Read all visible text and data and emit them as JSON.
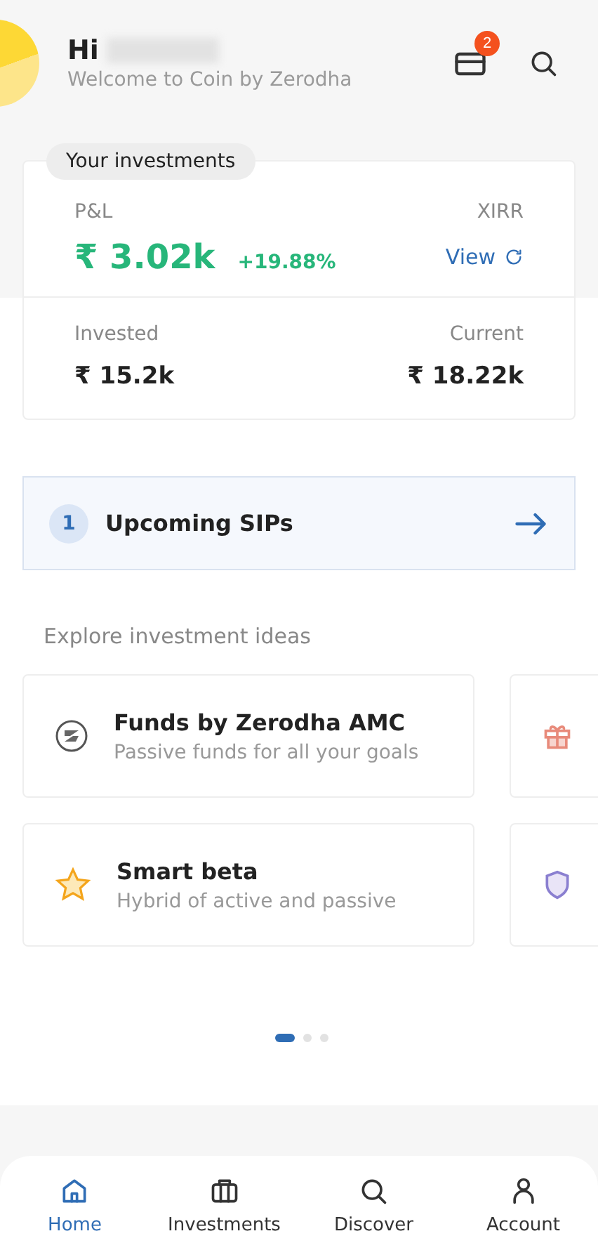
{
  "header": {
    "greeting": "Hi",
    "subtitle": "Welcome to Coin by Zerodha",
    "notification_count": "2"
  },
  "investments": {
    "tag": "Your investments",
    "pnl_label": "P&L",
    "pnl_value": "₹ 3.02k",
    "pnl_percent": "+19.88%",
    "xirr_label": "XIRR",
    "xirr_action": "View",
    "invested_label": "Invested",
    "invested_value": "₹ 15.2k",
    "current_label": "Current",
    "current_value": "₹ 18.22k"
  },
  "upcoming_sips": {
    "count": "1",
    "label": "Upcoming SIPs"
  },
  "explore": {
    "title": "Explore investment ideas",
    "ideas": [
      {
        "kind": "zerodha",
        "title": "Funds by Zerodha AMC",
        "subtitle": "Passive funds for all your goals"
      },
      {
        "kind": "gift"
      },
      {
        "kind": "star",
        "title": "Smart beta",
        "subtitle": "Hybrid of active and passive"
      },
      {
        "kind": "shield"
      }
    ],
    "pages": [
      {
        "selected": true
      },
      {
        "selected": false
      },
      {
        "selected": false
      }
    ]
  },
  "bottom_nav": [
    {
      "kind": "home",
      "label": "Home",
      "selected": true
    },
    {
      "kind": "briefcase",
      "label": "Investments",
      "selected": false
    },
    {
      "kind": "search",
      "label": "Discover",
      "selected": false
    },
    {
      "kind": "user",
      "label": "Account",
      "selected": false
    }
  ]
}
